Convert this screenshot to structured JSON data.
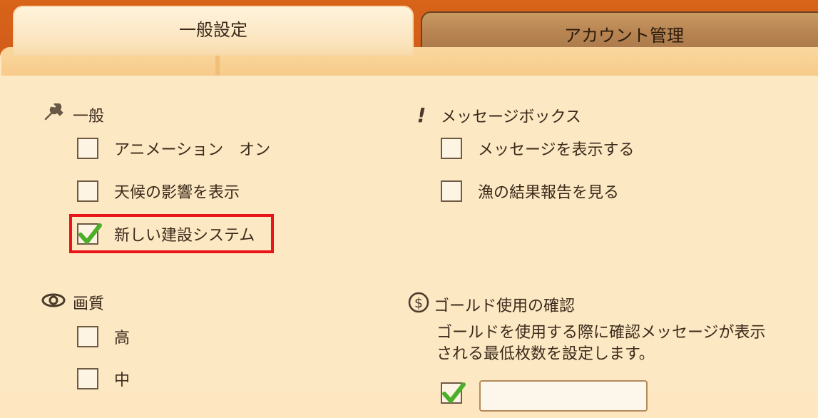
{
  "tabs": [
    {
      "label": "一般設定",
      "active": true
    },
    {
      "label": "アカウント管理",
      "active": false
    }
  ],
  "sections": {
    "general": {
      "title": "一般",
      "icon": "wrench-icon",
      "options": [
        {
          "label": "アニメーション　オン",
          "checked": false
        },
        {
          "label": "天候の影響を表示",
          "checked": false
        },
        {
          "label": "新しい建設システム",
          "checked": true
        }
      ]
    },
    "message_box": {
      "title": "メッセージボックス",
      "icon": "exclamation-icon",
      "options": [
        {
          "label": "メッセージを表示する",
          "checked": false
        },
        {
          "label": "漁の結果報告を見る",
          "checked": false
        }
      ]
    },
    "quality": {
      "title": "画質",
      "icon": "eye-icon",
      "options": [
        {
          "label": "高",
          "checked": false
        },
        {
          "label": "中",
          "checked": false
        }
      ]
    },
    "gold_confirm": {
      "title": "ゴールド使用の確認",
      "icon": "dollar-circle-icon",
      "description_line1": "ゴールドを使用する際に確認メッセージが表示",
      "description_line2": "される最低枚数を設定します。",
      "checked": true
    }
  },
  "colors": {
    "highlight": "#e8141a",
    "check": "#4caf2a"
  }
}
